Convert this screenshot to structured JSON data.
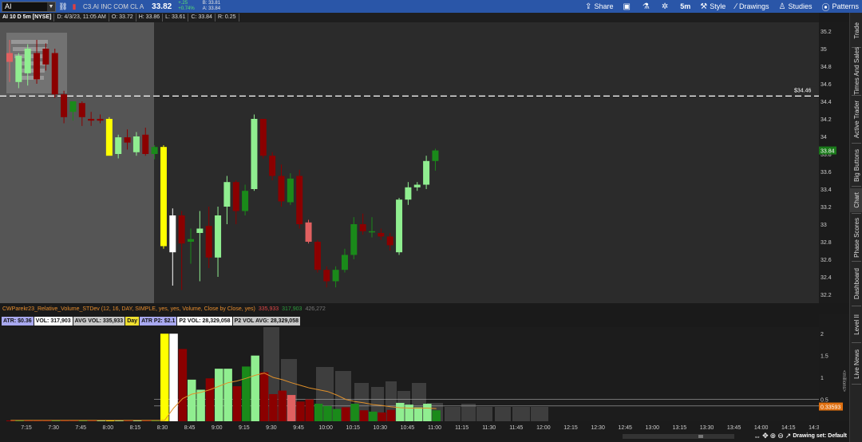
{
  "toolbar": {
    "symbol": "AI",
    "company": "C3.AI INC COM CL A",
    "last": "33.82",
    "change": "+.25",
    "change_pct": "+0.74%",
    "bid": "B: 33.81",
    "ask": "A: 33.84",
    "share_label": "Share",
    "timeframe_label": "5m",
    "style_label": "Style",
    "drawings_label": "Drawings",
    "studies_label": "Studies",
    "patterns_label": "Patterns"
  },
  "header": {
    "title": "AI 10 D 5m [NYSE]",
    "date": "D: 4/3/23, 11:05 AM",
    "open": "O: 33.72",
    "high": "H: 33.86",
    "low": "L: 33.61",
    "close": "C: 33.84",
    "range": "R: 0.25"
  },
  "price_axis": {
    "ticks": [
      "35.2",
      "35",
      "34.8",
      "34.6",
      "34.4",
      "34.2",
      "34",
      "33.8",
      "33.6",
      "33.4",
      "33.2",
      "33",
      "32.8",
      "32.6",
      "32.4",
      "32.2"
    ],
    "level_label": "$34.46",
    "current_label": "33.84"
  },
  "study": {
    "name": "CWParekr23_Relative_Volume_STDev (12, 16, DAY, SIMPLE, yes, yes, Volume, Close by Close, yes)",
    "v1": "335,933",
    "v2": "317,903",
    "v3": "426,272"
  },
  "labels": [
    {
      "text": "ATR: $0.36",
      "bg": "#a9a9f0"
    },
    {
      "text": "VOL: 317,903",
      "bg": "#ffffff"
    },
    {
      "text": "AVG VOL: 335,933",
      "bg": "#c8c8c8"
    },
    {
      "text": "Day",
      "bg": "#f0e030"
    },
    {
      "text": "ATR P2: $2.1",
      "bg": "#a9a9f0"
    },
    {
      "text": "P2 VOL: 28,329,058",
      "bg": "#ffffff"
    },
    {
      "text": "P2 VOL AVG: 28,329,058",
      "bg": "#c8c8c8"
    }
  ],
  "vol_axis": {
    "ticks": [
      "2",
      "1.5",
      "1",
      "0.5"
    ],
    "unit": "<millions>",
    "current_label": "0.33593"
  },
  "time_axis": [
    "7:15",
    "7:30",
    "7:45",
    "8:00",
    "8:15",
    "8:30",
    "8:45",
    "9:00",
    "9:15",
    "9:30",
    "9:45",
    "10:00",
    "10:15",
    "10:30",
    "10:45",
    "11:00",
    "11:15",
    "11:30",
    "11:45",
    "12:00",
    "12:15",
    "12:30",
    "12:45",
    "13:00",
    "13:15",
    "13:30",
    "13:45",
    "14:00",
    "14:15",
    "14:30"
  ],
  "bottom": {
    "drawing_set": "Drawing set: Default"
  },
  "sidebar": [
    "Trade",
    "Times And Sales",
    "Active Trader",
    "Big Buttons",
    "Chart",
    "Phase Scores",
    "Dashboard",
    "Level II",
    "Live News"
  ],
  "colors": {
    "up_light": "#90ee90",
    "up_dark": "#1a8a1a",
    "down_dark": "#8b0000",
    "down_light": "#e06060",
    "yellow": "#ffff00",
    "white": "#ffffff",
    "level_line": "#ffffff",
    "avg_line": "#e0902a"
  },
  "chart_data": {
    "type": "candlestick",
    "series": [
      {
        "name": "price",
        "values": [
          {
            "o": 34.95,
            "h": 35.1,
            "l": 34.62,
            "c": 34.85,
            "col": "down_light"
          },
          {
            "o": 34.62,
            "h": 34.95,
            "l": 34.55,
            "c": 34.92,
            "col": "up_light"
          },
          {
            "o": 34.72,
            "h": 35.05,
            "l": 34.58,
            "c": 35.0,
            "col": "up_light"
          },
          {
            "o": 34.95,
            "h": 35.1,
            "l": 34.6,
            "c": 34.65,
            "col": "down_dark"
          },
          {
            "o": 35.0,
            "h": 35.06,
            "l": 34.75,
            "c": 34.82,
            "col": "down_dark"
          },
          {
            "o": 34.95,
            "h": 35.0,
            "l": 34.44,
            "c": 34.48,
            "col": "down_dark"
          },
          {
            "o": 34.48,
            "h": 34.52,
            "l": 34.15,
            "c": 34.22,
            "col": "down_dark"
          },
          {
            "o": 34.28,
            "h": 34.36,
            "l": 34.18,
            "c": 34.4,
            "col": "up_dark"
          },
          {
            "o": 34.38,
            "h": 34.4,
            "l": 34.12,
            "c": 34.22,
            "col": "down_dark"
          },
          {
            "o": 34.2,
            "h": 34.28,
            "l": 34.12,
            "c": 34.18,
            "col": "down_dark"
          },
          {
            "o": 34.2,
            "h": 34.25,
            "l": 34.15,
            "c": 34.18,
            "col": "down_dark"
          },
          {
            "o": 34.2,
            "h": 34.22,
            "l": 33.85,
            "c": 33.78,
            "col": "yellow"
          },
          {
            "o": 33.8,
            "h": 34.02,
            "l": 33.75,
            "c": 33.99,
            "col": "up_light"
          },
          {
            "o": 33.99,
            "h": 34.08,
            "l": 33.85,
            "c": 33.93,
            "col": "down_dark"
          },
          {
            "o": 33.82,
            "h": 34.05,
            "l": 33.78,
            "c": 34.0,
            "col": "up_light"
          },
          {
            "o": 34.02,
            "h": 34.1,
            "l": 33.78,
            "c": 33.8,
            "col": "down_dark"
          },
          {
            "o": 33.8,
            "h": 33.9,
            "l": 33.74,
            "c": 33.88,
            "col": "up_dark"
          },
          {
            "o": 33.88,
            "h": 33.9,
            "l": 32.72,
            "c": 32.75,
            "col": "yellow"
          },
          {
            "o": 32.68,
            "h": 33.18,
            "l": 32.3,
            "c": 33.1,
            "col": "white"
          },
          {
            "o": 33.1,
            "h": 33.15,
            "l": 32.25,
            "c": 32.78,
            "col": "down_dark"
          },
          {
            "o": 32.8,
            "h": 32.95,
            "l": 32.55,
            "c": 32.83,
            "col": "up_dark"
          },
          {
            "o": 32.9,
            "h": 33.15,
            "l": 32.35,
            "c": 32.95,
            "col": "up_light"
          },
          {
            "o": 32.98,
            "h": 33.2,
            "l": 32.5,
            "c": 32.62,
            "col": "down_dark"
          },
          {
            "o": 32.62,
            "h": 33.2,
            "l": 32.4,
            "c": 33.1,
            "col": "up_light"
          },
          {
            "o": 33.2,
            "h": 33.55,
            "l": 33.0,
            "c": 33.48,
            "col": "up_light"
          },
          {
            "o": 33.48,
            "h": 33.5,
            "l": 33.0,
            "c": 33.15,
            "col": "down_dark"
          },
          {
            "o": 33.15,
            "h": 33.45,
            "l": 33.1,
            "c": 33.38,
            "col": "up_dark"
          },
          {
            "o": 33.4,
            "h": 34.25,
            "l": 33.38,
            "c": 34.2,
            "col": "up_light"
          },
          {
            "o": 34.2,
            "h": 34.18,
            "l": 33.75,
            "c": 33.78,
            "col": "down_dark"
          },
          {
            "o": 33.78,
            "h": 33.82,
            "l": 33.5,
            "c": 33.55,
            "col": "down_dark"
          },
          {
            "o": 33.55,
            "h": 33.68,
            "l": 33.2,
            "c": 33.26,
            "col": "down_dark"
          },
          {
            "o": 33.25,
            "h": 33.58,
            "l": 33.22,
            "c": 33.52,
            "col": "up_dark"
          },
          {
            "o": 33.55,
            "h": 33.62,
            "l": 32.95,
            "c": 33.0,
            "col": "down_dark"
          },
          {
            "o": 33.02,
            "h": 33.05,
            "l": 32.78,
            "c": 32.8,
            "col": "down_light"
          },
          {
            "o": 32.8,
            "h": 32.82,
            "l": 32.45,
            "c": 32.48,
            "col": "down_dark"
          },
          {
            "o": 32.48,
            "h": 32.52,
            "l": 32.28,
            "c": 32.35,
            "col": "down_dark"
          },
          {
            "o": 32.35,
            "h": 32.52,
            "l": 32.28,
            "c": 32.48,
            "col": "up_dark"
          },
          {
            "o": 32.48,
            "h": 32.72,
            "l": 32.45,
            "c": 32.65,
            "col": "up_dark"
          },
          {
            "o": 32.65,
            "h": 33.08,
            "l": 32.6,
            "c": 33.0,
            "col": "up_dark"
          },
          {
            "o": 33.0,
            "h": 33.12,
            "l": 32.88,
            "c": 32.92,
            "col": "down_dark"
          },
          {
            "o": 32.92,
            "h": 33.08,
            "l": 32.85,
            "c": 32.91,
            "col": "up_dark"
          },
          {
            "o": 32.9,
            "h": 32.95,
            "l": 32.82,
            "c": 32.86,
            "col": "down_dark"
          },
          {
            "o": 32.86,
            "h": 32.9,
            "l": 32.7,
            "c": 32.76,
            "col": "down_dark"
          },
          {
            "o": 32.68,
            "h": 33.3,
            "l": 32.65,
            "c": 33.28,
            "col": "up_light"
          },
          {
            "o": 33.28,
            "h": 33.48,
            "l": 33.22,
            "c": 33.42,
            "col": "up_light"
          },
          {
            "o": 33.42,
            "h": 33.48,
            "l": 33.38,
            "c": 33.45,
            "col": "up_light"
          },
          {
            "o": 33.45,
            "h": 33.78,
            "l": 33.4,
            "c": 33.72,
            "col": "up_light"
          },
          {
            "o": 33.72,
            "h": 33.86,
            "l": 33.61,
            "c": 33.84,
            "col": "up_dark"
          }
        ]
      }
    ],
    "level": 34.46,
    "ylim": [
      32.1,
      35.3
    ],
    "volume": [
      {
        "v": 0.02,
        "col": "down_dark"
      },
      {
        "v": 0.02,
        "col": "up_dark"
      },
      {
        "v": 0.02,
        "col": "down_dark"
      },
      {
        "v": 0.02,
        "col": "down_dark"
      },
      {
        "v": 0.02,
        "col": "down_dark"
      },
      {
        "v": 0.02,
        "col": "up_dark"
      },
      {
        "v": 0.02,
        "col": "down_dark"
      },
      {
        "v": 0.02,
        "col": "down_dark"
      },
      {
        "v": 0.02,
        "col": "up_dark"
      },
      {
        "v": 0.02,
        "col": "down_dark"
      },
      {
        "v": 0.02,
        "col": "up_light"
      },
      {
        "v": 0.02,
        "col": "yellow"
      },
      {
        "v": 0.02,
        "col": "up_light"
      },
      {
        "v": 0.02,
        "col": "down_dark"
      },
      {
        "v": 0.02,
        "col": "up_light"
      },
      {
        "v": 0.02,
        "col": "down_dark"
      },
      {
        "v": 0.02,
        "col": "up_dark"
      },
      {
        "v": 2.0,
        "col": "yellow"
      },
      {
        "v": 2.0,
        "col": "white"
      },
      {
        "v": 1.65,
        "col": "down_dark"
      },
      {
        "v": 0.95,
        "col": "up_light"
      },
      {
        "v": 0.72,
        "col": "up_light"
      },
      {
        "v": 0.98,
        "col": "down_dark"
      },
      {
        "v": 1.2,
        "col": "up_light"
      },
      {
        "v": 1.2,
        "col": "up_light"
      },
      {
        "v": 0.8,
        "col": "down_dark"
      },
      {
        "v": 1.25,
        "col": "up_dark"
      },
      {
        "v": 1.5,
        "col": "up_light"
      },
      {
        "v": 1.12,
        "col": "down_dark"
      },
      {
        "v": 0.62,
        "col": "down_dark"
      },
      {
        "v": 0.7,
        "col": "down_dark"
      },
      {
        "v": 0.6,
        "col": "down_light"
      },
      {
        "v": 0.45,
        "col": "down_dark"
      },
      {
        "v": 0.5,
        "col": "down_dark"
      },
      {
        "v": 0.4,
        "col": "up_dark"
      },
      {
        "v": 0.35,
        "col": "up_dark"
      },
      {
        "v": 0.28,
        "col": "up_dark"
      },
      {
        "v": 0.32,
        "col": "down_dark"
      },
      {
        "v": 0.4,
        "col": "up_dark"
      },
      {
        "v": 0.25,
        "col": "down_dark"
      },
      {
        "v": 0.22,
        "col": "up_dark"
      },
      {
        "v": 0.2,
        "col": "down_dark"
      },
      {
        "v": 0.26,
        "col": "down_dark"
      },
      {
        "v": 0.42,
        "col": "up_light"
      },
      {
        "v": 0.38,
        "col": "up_light"
      },
      {
        "v": 0.32,
        "col": "up_light"
      },
      {
        "v": 0.4,
        "col": "up_light"
      },
      {
        "v": 0.25,
        "col": "up_dark"
      }
    ],
    "avg_volume": [
      0.02,
      0.02,
      0.02,
      0.02,
      0.02,
      0.02,
      0.02,
      0.02,
      0.02,
      0.02,
      0.02,
      0.02,
      0.02,
      0.02,
      0.02,
      0.02,
      0.02,
      0.02,
      0.3,
      0.52,
      0.62,
      0.66,
      0.72,
      0.8,
      0.88,
      0.92,
      0.98,
      1.05,
      1.1,
      1.0,
      0.95,
      0.88,
      0.82,
      0.76,
      0.72,
      0.68,
      0.6,
      0.5,
      0.45,
      0.42,
      0.38,
      0.36,
      0.33,
      0.31,
      0.3,
      0.3,
      0.3,
      0.29
    ]
  }
}
